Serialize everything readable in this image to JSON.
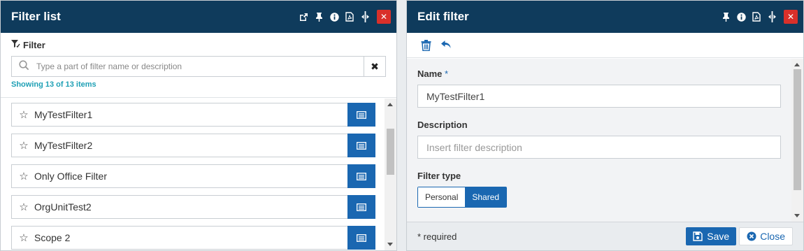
{
  "colors": {
    "titlebar": "#0f3b5c",
    "accent": "#1a67b1",
    "close": "#d9302a",
    "info": "#1fa0b5"
  },
  "left": {
    "title": "Filter list",
    "filter_label": "Filter",
    "search": {
      "placeholder": "Type a part of filter name or description",
      "value": ""
    },
    "showing": "Showing 13 of 13 items",
    "items": [
      {
        "label": "MyTestFilter1"
      },
      {
        "label": "MyTestFilter2"
      },
      {
        "label": "Only Office Filter"
      },
      {
        "label": "OrgUnitTest2"
      },
      {
        "label": "Scope 2"
      }
    ]
  },
  "right": {
    "title": "Edit filter",
    "name_label": "Name",
    "name_required_mark": "*",
    "name_value": "MyTestFilter1",
    "description_label": "Description",
    "description_placeholder": "Insert filter description",
    "filter_type_label": "Filter type",
    "filter_type_options": [
      "Personal",
      "Shared"
    ],
    "filter_type_selected": "Shared",
    "required_note": "* required",
    "save_label": "Save",
    "close_label": "Close"
  }
}
